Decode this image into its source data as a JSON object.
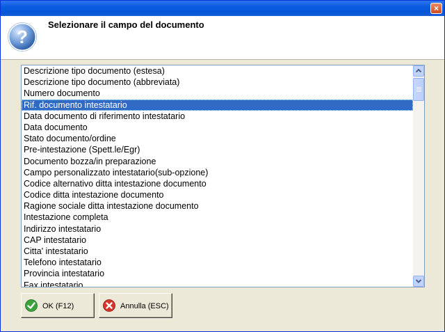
{
  "dialog": {
    "title": "Selezionare il campo del documento",
    "close_label": "×"
  },
  "fields": [
    "Descrizione tipo documento (estesa)",
    "Descrizione tipo documento (abbreviata)",
    "Numero documento",
    "Rif. documento intestatario",
    "Data documento di riferimento intestatario",
    "Data documento",
    "Stato documento/ordine",
    "Pre-intestazione (Spett.le/Egr)",
    "Documento bozza/in preparazione",
    "Campo personalizzato intestatario(sub-opzione)",
    "Codice alternativo ditta intestazione documento",
    "Codice ditta intestazione documento",
    "Ragione sociale ditta intestazione documento",
    "Intestazione completa",
    "Indirizzo intestatario",
    "CAP intestatario",
    "Citta' intestatario",
    "Telefono intestatario",
    "Provincia intestatario",
    "Fax intestatario"
  ],
  "selected_index": 3,
  "buttons": {
    "ok_label": "OK (F12)",
    "cancel_label": "Annulla (ESC)"
  },
  "icons": {
    "help": "question-mark-icon",
    "ok": "check-icon",
    "cancel": "x-icon"
  },
  "colors": {
    "selection": "#316AC5",
    "titlebar": "#0A5BE0",
    "dialog_bg": "#ECE9D8"
  }
}
